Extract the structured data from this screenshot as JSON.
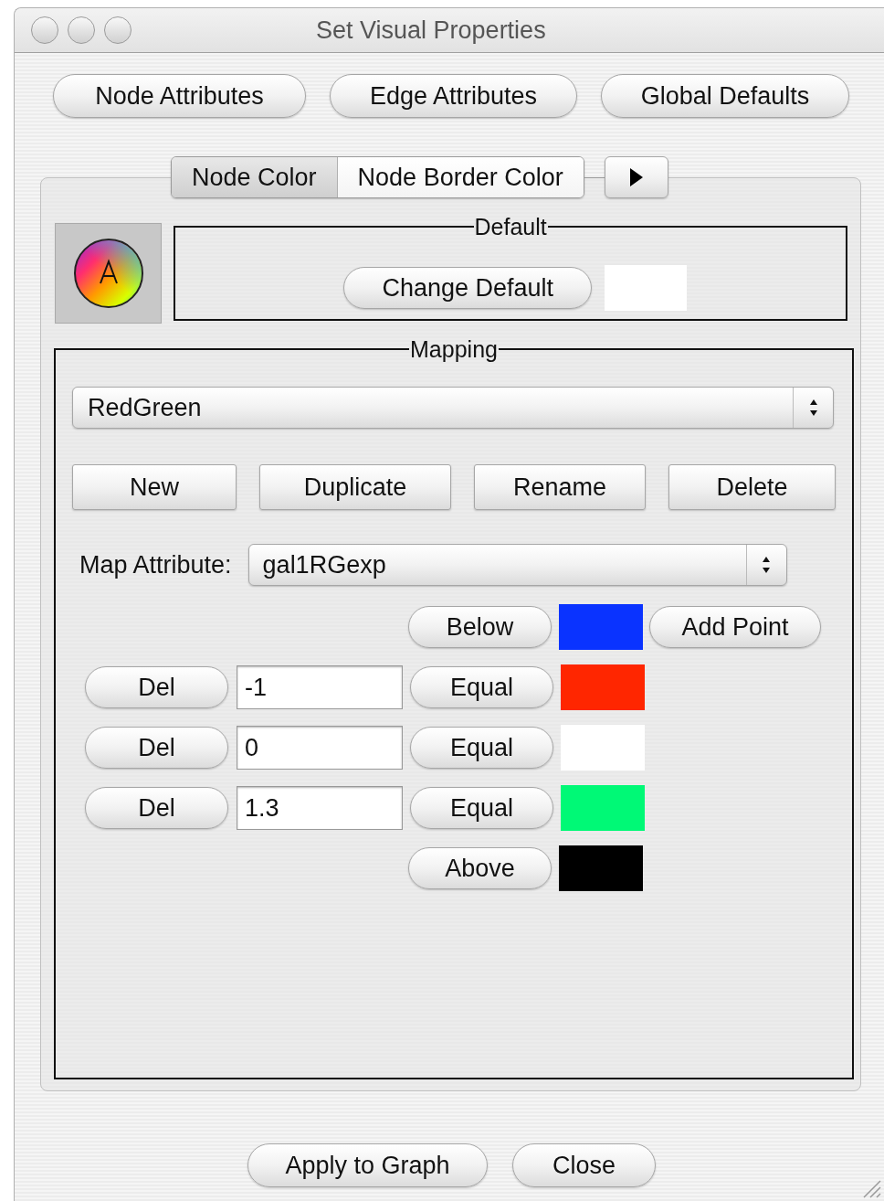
{
  "window": {
    "title": "Set Visual Properties"
  },
  "top_buttons": [
    "Node Attributes",
    "Edge Attributes",
    "Global Defaults"
  ],
  "tabs": [
    {
      "label": "Node Color",
      "selected": true
    },
    {
      "label": "Node Border Color",
      "selected": false
    }
  ],
  "default": {
    "title": "Default",
    "button": "Change Default",
    "color": "#ffffff"
  },
  "mapping": {
    "title": "Mapping",
    "calculator": "RedGreen",
    "buttons": [
      "New",
      "Duplicate",
      "Rename",
      "Delete"
    ],
    "map_attribute_label": "Map Attribute:",
    "map_attribute": "gal1RGexp",
    "below": {
      "button": "Below",
      "color": "#0a33ff"
    },
    "add_point": "Add Point",
    "points": [
      {
        "delete": "Del",
        "value": "-1",
        "button": "Equal",
        "color": "#ff2600"
      },
      {
        "delete": "Del",
        "value": "0",
        "button": "Equal",
        "color": "#ffffff"
      },
      {
        "delete": "Del",
        "value": "1.3",
        "button": "Equal",
        "color": "#00f976"
      }
    ],
    "above": {
      "button": "Above",
      "color": "#000000"
    }
  },
  "footer_buttons": [
    "Apply to Graph",
    "Close"
  ]
}
